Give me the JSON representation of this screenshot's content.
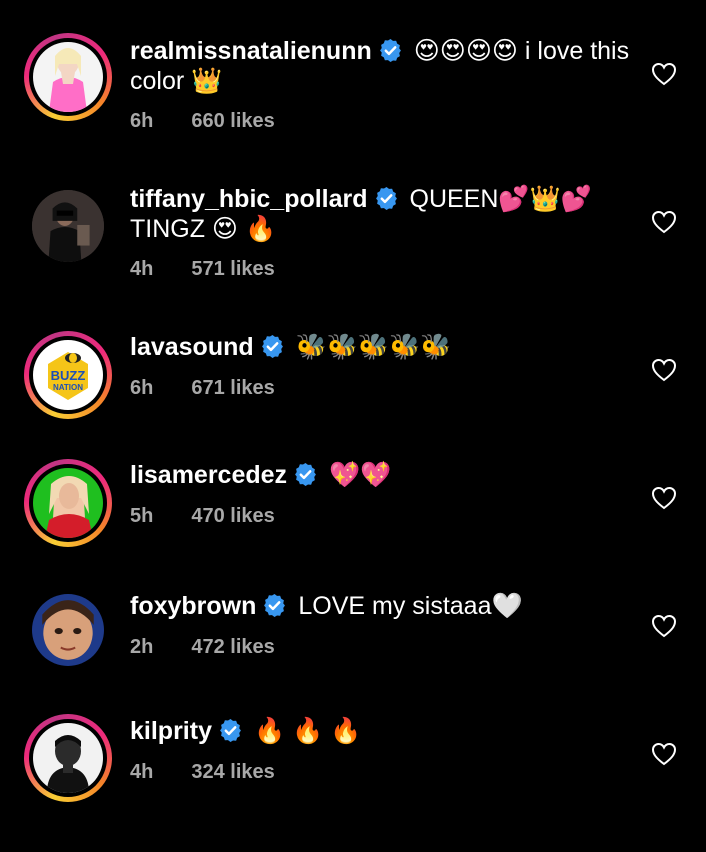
{
  "comments": [
    {
      "username": "realmissnatalienunn",
      "text": "😍😍😍😍 i love this color 👑",
      "time": "6h",
      "likes": "660 likes",
      "avatar_ring": "story",
      "avatar_icon": "avatar-pink-outfit"
    },
    {
      "username": "tiffany_hbic_pollard",
      "text": "QUEEN💕👑💕TINGZ 😍 🔥",
      "time": "4h",
      "likes": "571 likes",
      "avatar_ring": "plain",
      "avatar_icon": "avatar-dark-portrait"
    },
    {
      "username": "lavasound",
      "text": "🐝🐝🐝🐝🐝",
      "time": "6h",
      "likes": "671 likes",
      "avatar_ring": "story",
      "avatar_icon": "avatar-buzz-nation-logo",
      "avatar_logo_text": [
        "BUZZ",
        "NATION"
      ]
    },
    {
      "username": "lisamercedez",
      "text": "💖💖",
      "time": "5h",
      "likes": "470 likes",
      "avatar_ring": "story",
      "avatar_icon": "avatar-green-background"
    },
    {
      "username": "foxybrown",
      "text": "LOVE my sistaaa🤍",
      "time": "2h",
      "likes": "472 likes",
      "avatar_ring": "plain",
      "avatar_icon": "avatar-face-closeup"
    },
    {
      "username": "kilprity",
      "text": "🔥 🔥 🔥",
      "time": "4h",
      "likes": "324 likes",
      "avatar_ring": "story",
      "avatar_icon": "avatar-bw-portrait"
    }
  ],
  "colors": {
    "background": "#000000",
    "text": "#ffffff",
    "meta": "#a8a8a8",
    "verified": "#3897f0",
    "heart_outline": "#ffffff"
  },
  "icons": {
    "verified": "verified-badge-icon",
    "like": "heart-outline-icon"
  }
}
